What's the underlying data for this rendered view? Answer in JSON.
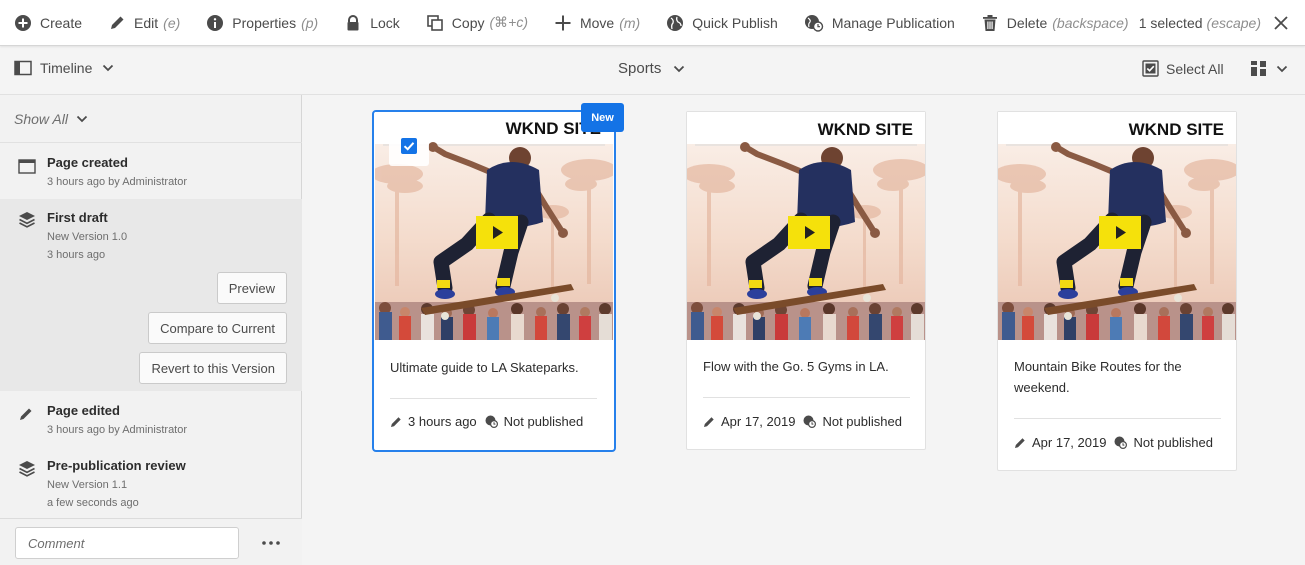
{
  "actionbar": {
    "create": "Create",
    "edit": "Edit",
    "edit_kbd": "(e)",
    "properties": "Properties",
    "properties_kbd": "(p)",
    "lock": "Lock",
    "copy": "Copy",
    "copy_kbd": "(⌘+c)",
    "move": "Move",
    "move_kbd": "(m)",
    "quick_publish": "Quick Publish",
    "manage_publication": "Manage Publication",
    "delete": "Delete",
    "delete_kbd": "(backspace)",
    "selected_text": "1 selected",
    "selected_kbd": "(escape)"
  },
  "toolbar": {
    "rail_label": "Timeline",
    "title": "Sports",
    "select_all": "Select All"
  },
  "rail": {
    "filter": "Show All",
    "comment_placeholder": "Comment",
    "items": [
      {
        "title": "Page created",
        "sub1": "3 hours ago by Administrator",
        "icon": "page-icon"
      },
      {
        "title": "First draft",
        "sub1": "New Version 1.0",
        "sub2": "3 hours ago",
        "icon": "layers-icon"
      },
      {
        "title": "Page edited",
        "sub1": "3 hours ago by Administrator",
        "icon": "pencil-icon"
      },
      {
        "title": "Pre-publication review",
        "sub1": "New Version 1.1",
        "sub2": "a few seconds ago",
        "icon": "layers-icon"
      }
    ],
    "version_actions": {
      "preview": "Preview",
      "compare": "Compare to Current",
      "revert": "Revert to this Version"
    }
  },
  "cards": [
    {
      "brand": "WKND SITE",
      "title": "Ultimate guide to LA Skateparks.",
      "modified": "3 hours ago",
      "status": "Not published",
      "badge": "New",
      "selected": true
    },
    {
      "brand": "WKND SITE",
      "title": "Flow with the Go. 5 Gyms in LA.",
      "modified": "Apr 17, 2019",
      "status": "Not published",
      "selected": false
    },
    {
      "brand": "WKND SITE",
      "title": "Mountain Bike Routes for the weekend.",
      "modified": "Apr 17, 2019",
      "status": "Not published",
      "selected": false
    }
  ],
  "colors": {
    "accent": "#2680eb",
    "badge": "#1473e6",
    "play_button": "#f5e10b"
  }
}
